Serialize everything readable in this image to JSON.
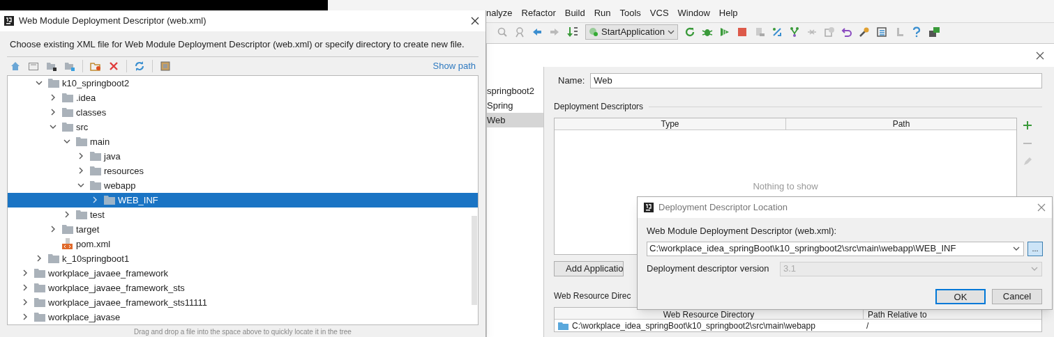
{
  "ide": {
    "menu": [
      "nalyze",
      "Refactor",
      "Build",
      "Run",
      "Tools",
      "VCS",
      "Window",
      "Help"
    ],
    "run_config": "StartApplication"
  },
  "project_structure": {
    "modules": [
      {
        "label": "springboot2",
        "selected": false
      },
      {
        "label": "Spring",
        "selected": false
      },
      {
        "label": "Web",
        "selected": true
      }
    ],
    "name_label": "Name:",
    "name_value": "Web",
    "descriptors_title": "Deployment Descriptors",
    "descriptor_columns": [
      "Type",
      "Path"
    ],
    "empty_text": "Nothing to show",
    "add_button": "Add Applicatio",
    "resources_title": "Web Resource Direc",
    "resource_columns": [
      "Web Resource Directory",
      "Path Relative to"
    ],
    "resource_rows": [
      {
        "directory": "C:\\workplace_idea_springBoot\\k10_springboot2\\src\\main\\webapp",
        "relative": "/"
      }
    ]
  },
  "chooser": {
    "title": "Web Module Deployment Descriptor (web.xml)",
    "description": "Choose existing XML file for Web Module Deployment Descriptor (web.xml) or specify directory to create new file.",
    "show_path": "Show path",
    "tree": [
      {
        "kind": "hidden",
        "children": [
          {
            "label": "k10_springboot2",
            "kind": "folder",
            "expanded": true,
            "selected": false,
            "children": [
              {
                "label": ".idea",
                "kind": "folder",
                "expanded": false,
                "selected": false
              },
              {
                "label": "classes",
                "kind": "folder",
                "expanded": false,
                "selected": false
              },
              {
                "label": "src",
                "kind": "folder",
                "expanded": true,
                "selected": false,
                "children": [
                  {
                    "label": "main",
                    "kind": "folder",
                    "expanded": true,
                    "selected": false,
                    "children": [
                      {
                        "label": "java",
                        "kind": "folder",
                        "expanded": false,
                        "selected": false
                      },
                      {
                        "label": "resources",
                        "kind": "folder",
                        "expanded": false,
                        "selected": false
                      },
                      {
                        "label": "webapp",
                        "kind": "folder",
                        "expanded": true,
                        "selected": false,
                        "children": [
                          {
                            "label": "WEB_INF",
                            "kind": "folder",
                            "expanded": false,
                            "selected": true
                          }
                        ]
                      }
                    ]
                  },
                  {
                    "label": "test",
                    "kind": "folder",
                    "expanded": false,
                    "selected": false
                  }
                ]
              },
              {
                "label": "target",
                "kind": "folder",
                "expanded": false,
                "selected": false
              },
              {
                "label": "pom.xml",
                "kind": "file",
                "selected": false
              }
            ]
          },
          {
            "label": "k_10springboot1",
            "kind": "folder",
            "expanded": false,
            "selected": false
          }
        ]
      },
      {
        "label": "workplace_javaee_framework",
        "kind": "folder",
        "expanded": false,
        "selected": false
      },
      {
        "label": "workplace_javaee_framework_sts",
        "kind": "folder",
        "expanded": false,
        "selected": false
      },
      {
        "label": "workplace_javaee_framework_sts11111",
        "kind": "folder",
        "expanded": false,
        "selected": false
      },
      {
        "label": "workplace_javase",
        "kind": "folder",
        "expanded": false,
        "selected": false
      }
    ],
    "hint": "Drag and drop a file into the space above to quickly locate it in the tree"
  },
  "location_dialog": {
    "title": "Deployment Descriptor Location",
    "descriptor_label": "Web Module Deployment Descriptor (web.xml):",
    "descriptor_value": "C:\\workplace_idea_springBoot\\k10_springboot2\\src\\main\\webapp\\WEB_INF",
    "browse": "...",
    "version_label": "Deployment descriptor version",
    "version_value": "3.1",
    "version_disabled": true,
    "buttons": [
      {
        "label": "OK",
        "default": true
      },
      {
        "label": "Cancel",
        "default": false
      }
    ]
  }
}
